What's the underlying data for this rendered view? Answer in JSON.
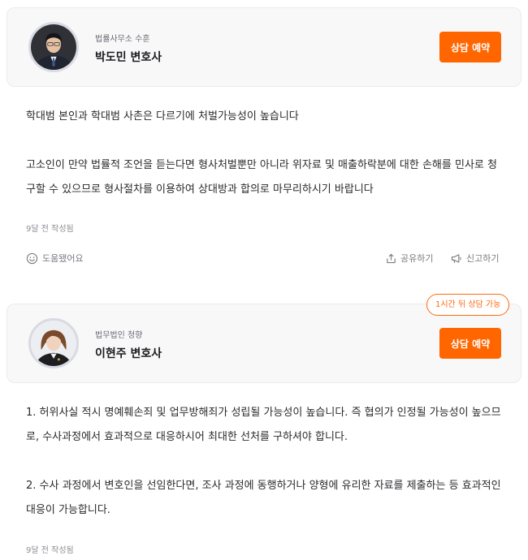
{
  "answers": [
    {
      "firm": "법률사무소 수훈",
      "lawyer": "박도민 변호사",
      "consult_label": "상담 예약",
      "paragraphs": [
        "학대범 본인과 학대범 사촌은 다르기에 처벌가능성이 높습니다",
        "고소인이 만약 법률적 조언을 듣는다면 형사처벌뿐만 아니라 위자료 및 매출하락분에 대한 손해를 민사로 청구할 수 있으므로 형사절차를 이용하여 상대방과 합의로 마무리하시기 바랍니다"
      ],
      "posted": "9달 전 작성됨",
      "helpful_label": "도움됐어요",
      "share_label": "공유하기",
      "report_label": "신고하기"
    },
    {
      "firm": "법무법인 청향",
      "lawyer": "이현주 변호사",
      "consult_label": "상담 예약",
      "availability": "1시간 뒤 상담 가능",
      "paragraphs": [
        "1. 허위사실 적시 명예훼손죄 및 업무방해죄가 성립될 가능성이 높습니다. 즉 협의가 인정될 가능성이 높으므로, 수사과정에서 효과적으로 대응하시어 최대한 선처를 구하셔야 합니다.",
        "2. 수사 과정에서 변호인을 선임한다면, 조사 과정에 동행하거나 양형에 유리한 자료를 제출하는 등 효과적인 대응이 가능합니다."
      ],
      "posted": "9달 전 작성됨"
    }
  ],
  "colors": {
    "accent": "#ff6600",
    "card_bg": "#f8f8f9",
    "text": "#2a2a2e",
    "muted": "#8e8e96"
  },
  "icons": [
    "smile-icon",
    "share-icon",
    "megaphone-icon"
  ]
}
